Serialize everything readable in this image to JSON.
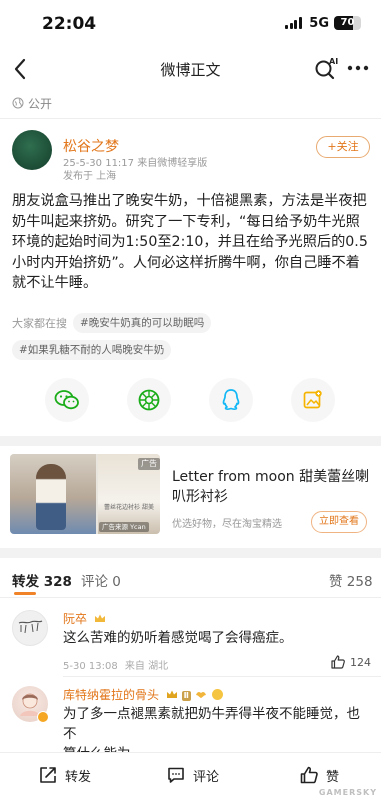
{
  "status_bar": {
    "time": "22:04",
    "network": "5G",
    "battery": "70",
    "battery_level": 0.7
  },
  "nav": {
    "title": "微博正文"
  },
  "visibility": {
    "label": "公开"
  },
  "post": {
    "author": "松谷之梦",
    "meta_line1": "25-5-30 11:17  来自微博轻享版",
    "meta_line2": "发布于 上海",
    "follow_label": "+关注",
    "body_lines": [
      "朋友说盒马推出了晚安牛奶，十倍褪黑素，方法是半夜把",
      "奶牛叫起来挤奶。研究了一下专利，“每日给予奶牛光照",
      "环境的起始时间为1:50至2:10，并且在给予光照后的0.5",
      "小时内开始挤奶”。人何必这样折腾牛啊，你自己睡不着",
      "就不让牛睡。"
    ]
  },
  "topics": {
    "label": "大家都在搜",
    "tag1": "#晚安牛奶真的可以助眠吗",
    "tag2": "#如果乳糖不耐的人喝晚安牛奶"
  },
  "share": {
    "icons": [
      "wechat-icon",
      "moments-icon",
      "qq-icon",
      "qzone-icon"
    ],
    "colors": {
      "wechat": "#1aad19",
      "moments": "#1aad19",
      "qq": "#12b7f5",
      "qzone": "#f5b400"
    }
  },
  "ad": {
    "corner_label": "广告",
    "image_small_text": "蕾丝花边衬衫 甜美",
    "image_source": "广告来源 Ycan",
    "title": "Letter from moon 甜美蕾丝喇叭形衬衫",
    "sub": "优选好物，尽在淘宝精选",
    "button": "立即查看"
  },
  "tabs": {
    "repost_label": "转发",
    "repost_count": "328",
    "comment_label": "评论",
    "comment_count": "0",
    "like_label": "赞",
    "like_count": "258"
  },
  "comments": [
    {
      "name": "阮卒",
      "text": "这么苦难的奶听着感觉喝了会得癌症。",
      "time": "5-30 13:08",
      "source": "来自 湖北",
      "likes": "124"
    },
    {
      "name": "库特纳霍拉的骨头",
      "level": "Ⅱ",
      "text_lines": [
        "为了多一点褪黑素就把奶牛弄得半夜不能睡觉，也不",
        "算什么能为"
      ]
    }
  ],
  "bottom_bar": {
    "repost": "转发",
    "comment": "评论",
    "like": "赞"
  },
  "watermark": "GAMERSKY",
  "colors": {
    "accent": "#e2761a",
    "tab_indicator": "#f08327"
  }
}
